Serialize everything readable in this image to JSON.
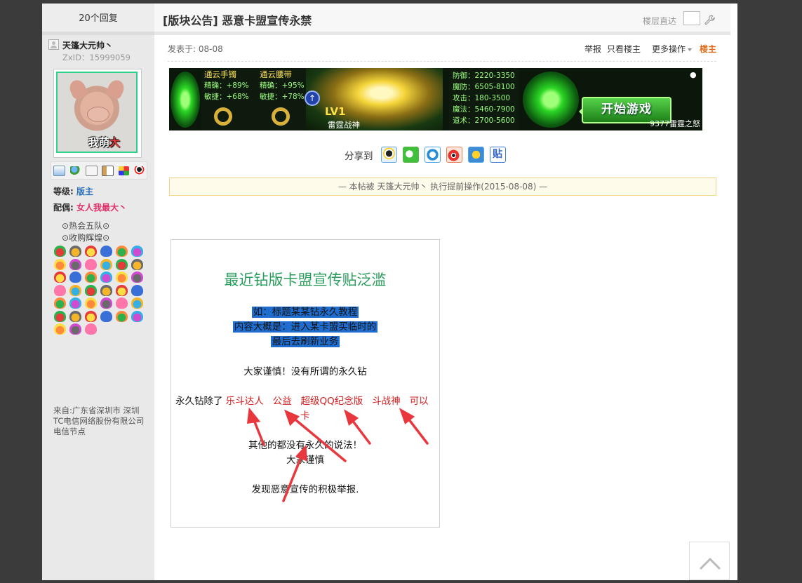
{
  "sidebar": {
    "reply_count": "20个回复",
    "username": "天篷大元帅丶",
    "zxid": "ZxID：15999059",
    "avatar_text_white": "我萌",
    "avatar_text_red": "大",
    "level_label": "等级:",
    "level_value": "版主",
    "spouse_label": "配偶:",
    "spouse_value": "女人我最大丶",
    "groups": [
      "热会五队",
      "收购辉煌"
    ],
    "from": "来自:广东省深圳市 深圳TC电信网络股份有限公司电信节点"
  },
  "post": {
    "title": "[版块公告] 恶意卡盟宣传永禁",
    "floor_jump_label": "楼层直达",
    "date": "发表于: 08-08",
    "actions": {
      "report": "举报",
      "only_owner": "只看楼主",
      "more": "更多操作",
      "owner_badge": "楼主"
    },
    "share_label": "分享到",
    "notice": "— 本帖被 天篷大元帅丶 执行提前操作(2015-08-08) —"
  },
  "banner": {
    "col1_title": "通云手镯",
    "col1_lines": [
      "精确：+89%",
      "敏捷：+68%"
    ],
    "col2_title": "通云腰带",
    "col2_lines": [
      "精确：+95%",
      "敏捷：+78%"
    ],
    "level": "LV1",
    "hero_name": "雷霆战神",
    "stats": [
      "防御：2220-3350",
      "魔防：6505-8100",
      "攻击：180-3500",
      "魔法：5460-7900",
      "道术：2700-5600"
    ],
    "start_button": "开始游戏",
    "brand": "9377雷霆之怒"
  },
  "image_post": {
    "title": "最近钻版卡盟宣传贴泛滥",
    "highlight_lines": [
      "如：标题某某钻永久教程",
      "内容大概是：进入某卡盟买临时的",
      "最后去刷新业务"
    ],
    "warning": "大家谨慎！没有所谓的永久钻",
    "permanent_prefix": "永久钻除了",
    "permanent_items": [
      "乐斗达人",
      "公益",
      "超级QQ纪念版",
      "斗战神",
      "可以"
    ],
    "wrap_char": "卡",
    "other_line": "其他的都没有永久的说法！",
    "careful": "大家谨慎",
    "report_line": "发现恶意宣传的积极举报."
  },
  "colors": {
    "level_blue": "#2b6fb8",
    "spouse_pink": "#e0306c",
    "owner_orange": "#e06b1a",
    "title_green": "#2a9d5c",
    "arrow_red": "#e8383d",
    "highlight_blue": "#1f6ecf"
  },
  "icons": [
    "user-icon",
    "mail-icon",
    "add-friend-icon",
    "search-icon",
    "profile-card-icon",
    "blocks-icon",
    "qq-icon",
    "wrench-icon",
    "qq-share-icon",
    "wechat-share-icon",
    "qzone-share-icon",
    "weibo-share-icon",
    "favorite-star-icon",
    "tieba-share-icon",
    "scroll-top-icon"
  ]
}
